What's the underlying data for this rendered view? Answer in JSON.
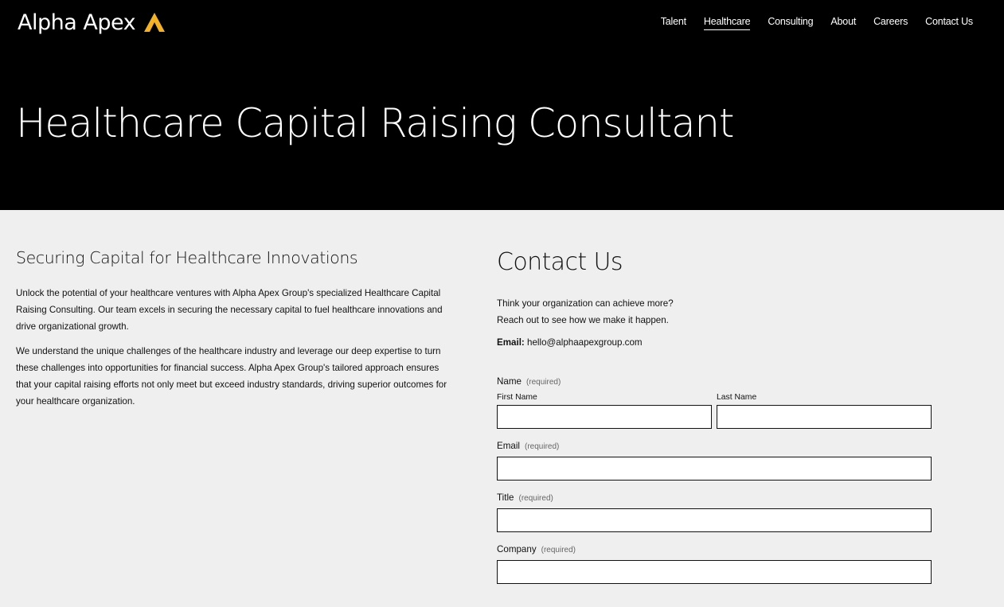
{
  "brand": {
    "name": "Alpha Apex",
    "mark_color": "#f5b324"
  },
  "nav": {
    "items": [
      {
        "label": "Talent",
        "active": false
      },
      {
        "label": "Healthcare",
        "active": true
      },
      {
        "label": "Consulting",
        "active": false
      },
      {
        "label": "About",
        "active": false
      },
      {
        "label": "Careers",
        "active": false
      },
      {
        "label": "Contact Us",
        "active": false
      }
    ]
  },
  "hero": {
    "title": "Healthcare Capital Raising Consultant"
  },
  "intro": {
    "heading": "Securing Capital for Healthcare Innovations",
    "paragraphs": [
      "Unlock the potential of your healthcare ventures with Alpha Apex Group's specialized Healthcare Capital Raising Consulting. Our team excels in securing the necessary capital to fuel healthcare innovations and drive organizational growth.",
      "We understand the unique challenges of the healthcare industry and leverage our deep expertise to turn these challenges into opportunities for financial success. Alpha Apex Group's tailored approach ensures that your capital raising efforts not only meet but exceed industry standards, driving superior outcomes for your healthcare organization."
    ]
  },
  "contact": {
    "heading": "Contact Us",
    "line1": "Think your organization can achieve more?",
    "line2": "Reach out to see how we make it happen.",
    "email_label": "Email:",
    "email_value": "hello@alphaapexgroup.com"
  },
  "form": {
    "required_text": "(required)",
    "name": {
      "label": "Name",
      "first_label": "First Name",
      "last_label": "Last Name",
      "first_value": "",
      "last_value": ""
    },
    "email": {
      "label": "Email",
      "value": ""
    },
    "title": {
      "label": "Title",
      "value": ""
    },
    "company": {
      "label": "Company",
      "value": ""
    }
  }
}
